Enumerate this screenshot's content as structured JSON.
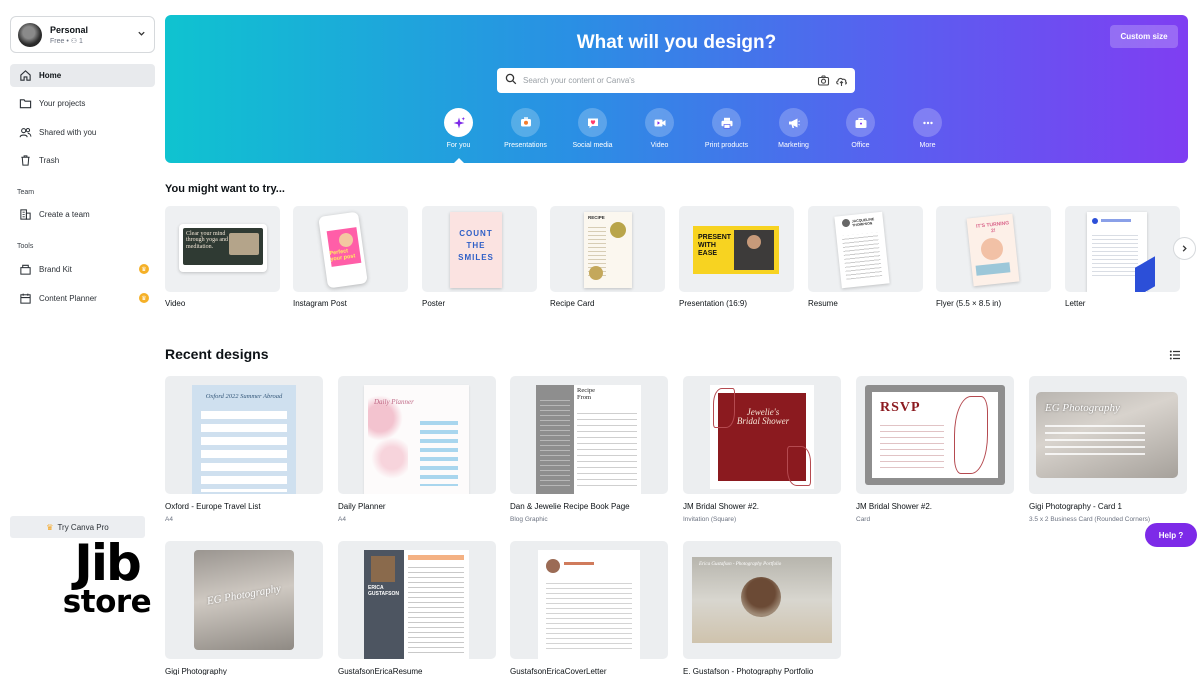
{
  "account": {
    "name": "Personal",
    "plan": "Free • ⚇ 1"
  },
  "sidebar": {
    "items": [
      {
        "label": "Home"
      },
      {
        "label": "Your projects"
      },
      {
        "label": "Shared with you"
      },
      {
        "label": "Trash"
      }
    ],
    "team_label": "Team",
    "team_items": [
      {
        "label": "Create a team"
      }
    ],
    "tools_label": "Tools",
    "tools_items": [
      {
        "label": "Brand Kit"
      },
      {
        "label": "Content Planner"
      }
    ],
    "try_pro": "Try Canva Pro"
  },
  "watermark": {
    "line1": "Jib",
    "line2": "store"
  },
  "hero": {
    "title": "What will you design?",
    "custom_size": "Custom size",
    "search_placeholder": "Search your content or Canva's",
    "categories": [
      {
        "label": "For you",
        "icon": "sparkle-icon"
      },
      {
        "label": "Presentations",
        "icon": "presentation-icon"
      },
      {
        "label": "Social media",
        "icon": "heart-chat-icon"
      },
      {
        "label": "Video",
        "icon": "video-icon"
      },
      {
        "label": "Print products",
        "icon": "printer-icon"
      },
      {
        "label": "Marketing",
        "icon": "megaphone-icon"
      },
      {
        "label": "Office",
        "icon": "briefcase-icon"
      },
      {
        "label": "More",
        "icon": "more-icon"
      }
    ]
  },
  "templates": {
    "title": "You might want to try...",
    "items": [
      {
        "label": "Video",
        "text": "Clear your mind through yoga and meditation."
      },
      {
        "label": "Instagram Post",
        "text": "Perfect your post"
      },
      {
        "label": "Poster",
        "text": "COUNT THE SMILES"
      },
      {
        "label": "Recipe Card",
        "text": "RECIPE"
      },
      {
        "label": "Presentation (16:9)",
        "text": "PRESENT WITH EASE"
      },
      {
        "label": "Resume",
        "text": "JACQUELINE THOMPSON"
      },
      {
        "label": "Flyer (5.5 × 8.5 in)",
        "text": "IT'S TURNING 2!"
      },
      {
        "label": "Letter",
        "text": ""
      }
    ]
  },
  "recent": {
    "title": "Recent designs",
    "items": [
      {
        "title": "Oxford - Europe Travel List",
        "type": "A4",
        "text": "Oxford 2022 Summer Abroad"
      },
      {
        "title": "Daily Planner",
        "type": "A4",
        "text": "Daily Planner"
      },
      {
        "title": "Dan & Jewelie Recipe Book Page",
        "type": "Blog Graphic",
        "text": "Recipe From"
      },
      {
        "title": "JM Bridal Shower #2.",
        "type": "Invitation (Square)",
        "text": "Jewelie's Bridal Shower"
      },
      {
        "title": "JM Bridal Shower #2.",
        "type": "Card",
        "text": "RSVP"
      },
      {
        "title": "Gigi Photography - Card 1",
        "type": "3.5 x 2 Business Card (Rounded Corners)",
        "text": "EG Photography"
      },
      {
        "title": "Gigi Photography",
        "type": "",
        "text": "EG Photography"
      },
      {
        "title": "GustafsonEricaResume",
        "type": "",
        "text": "ERICA GUSTAFSON"
      },
      {
        "title": "GustafsonEricaCoverLetter",
        "type": "",
        "text": ""
      },
      {
        "title": "E. Gustafson - Photography Portfolio",
        "type": "",
        "text": "Erica Gustafson - Photography Portfolio"
      }
    ]
  },
  "help": {
    "label": "Help ?"
  },
  "colors": {
    "accent": "#7d2ae8",
    "hero_start": "#0fc3d0",
    "hero_end": "#7f3ef2",
    "crown": "#f5b027"
  }
}
